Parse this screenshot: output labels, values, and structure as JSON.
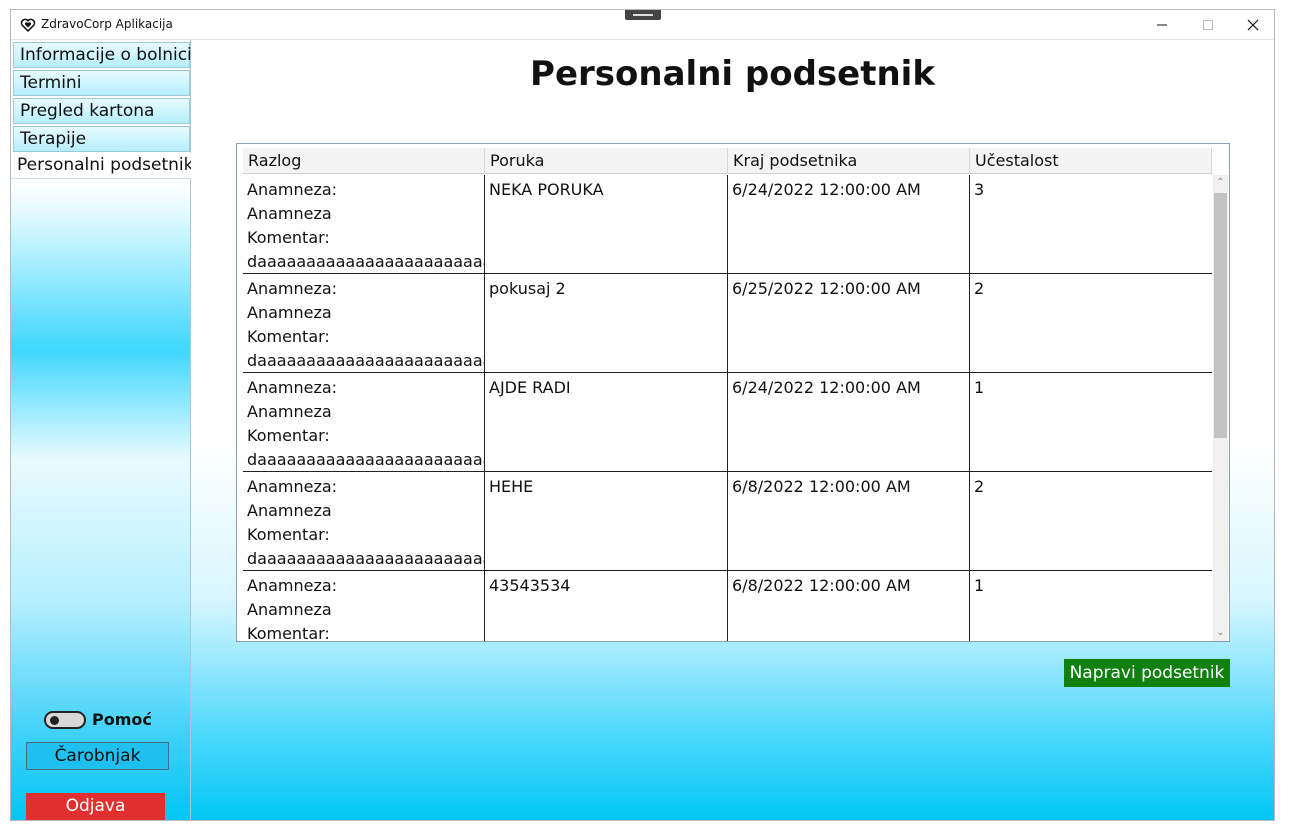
{
  "window": {
    "title": "ZdravoCorp Aplikacija"
  },
  "sidebar": {
    "tabs": [
      {
        "label": "Informacije o bolnici"
      },
      {
        "label": "Termini"
      },
      {
        "label": "Pregled kartona"
      },
      {
        "label": "Terapije"
      },
      {
        "label": "Personalni podsetnik"
      }
    ],
    "help_label": "Pomoć",
    "wizard_label": "Čarobnjak",
    "logout_label": "Odjava"
  },
  "main": {
    "title": "Personalni podsetnik",
    "table": {
      "columns": [
        "Razlog",
        "Poruka",
        "Kraj podsetnika",
        "Učestalost"
      ],
      "rows": [
        {
          "razlog": [
            "Anamneza:",
            "Anamneza",
            "Komentar:",
            "daaaaaaaaaaaaaaaaaaaaaaaa"
          ],
          "poruka": "NEKA PORUKA",
          "kraj": "6/24/2022 12:00:00 AM",
          "ucestalost": "3"
        },
        {
          "razlog": [
            "Anamneza:",
            "Anamneza",
            "Komentar:",
            "daaaaaaaaaaaaaaaaaaaaaaaa"
          ],
          "poruka": "pokusaj 2",
          "kraj": "6/25/2022 12:00:00 AM",
          "ucestalost": "2"
        },
        {
          "razlog": [
            "Anamneza:",
            "Anamneza",
            "Komentar:",
            "daaaaaaaaaaaaaaaaaaaaaaaa"
          ],
          "poruka": "AJDE RADI",
          "kraj": "6/24/2022 12:00:00 AM",
          "ucestalost": "1"
        },
        {
          "razlog": [
            "Anamneza:",
            "Anamneza",
            "Komentar:",
            "daaaaaaaaaaaaaaaaaaaaaaaa"
          ],
          "poruka": "HEHE",
          "kraj": "6/8/2022 12:00:00 AM",
          "ucestalost": "2"
        },
        {
          "razlog": [
            "Anamneza:",
            "Anamneza",
            "Komentar:"
          ],
          "poruka": "43543534",
          "kraj": "6/8/2022 12:00:00 AM",
          "ucestalost": "1"
        }
      ]
    },
    "create_button_label": "Napravi podsetnik"
  },
  "colors": {
    "create_button": "#108010",
    "logout_button": "#e23030",
    "wizard_button": "#1ec0f0",
    "accent_cyan": "#00c6f5"
  },
  "icons": {
    "app": "heart-icon",
    "minimize": "minimize-icon",
    "maximize": "maximize-icon",
    "close": "close-icon"
  }
}
